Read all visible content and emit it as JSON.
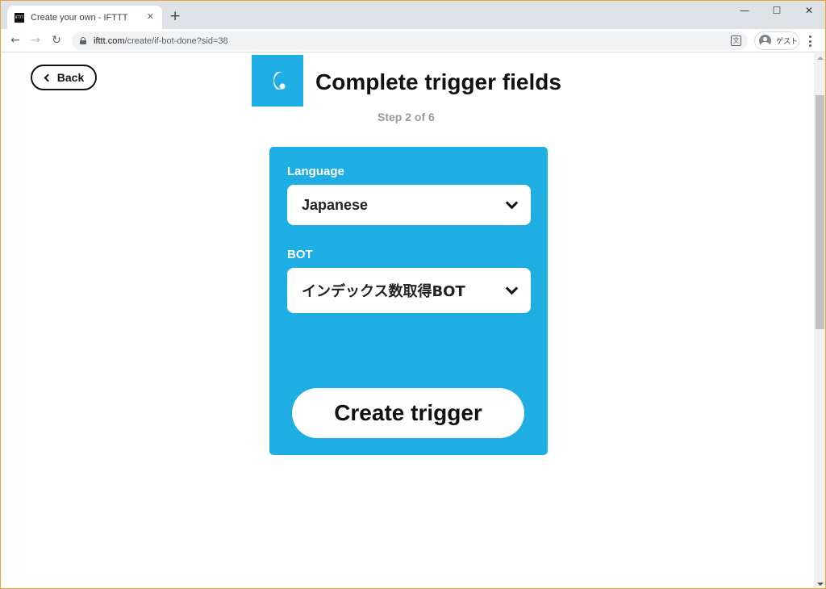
{
  "browser": {
    "tab_title": "Create your own - IFTTT",
    "favicon_text": "IFTTT",
    "new_tab_symbol": "+",
    "close_tab_symbol": "✕",
    "url_host": "ifttt.com",
    "url_path": "/create/if-bot-done?sid=38",
    "translate_symbol": "文",
    "profile_name": "ゲスト",
    "window_controls": {
      "minimize": "—",
      "maximize": "☐",
      "close": "✕"
    },
    "nav": {
      "back": "←",
      "forward": "→",
      "reload": "↻"
    }
  },
  "page": {
    "back_label": "Back",
    "title": "Complete trigger fields",
    "step": "Step 2 of 6",
    "service_color": "#1faee4"
  },
  "form": {
    "fields": [
      {
        "label": "Language",
        "value": "Japanese"
      },
      {
        "label": "BOT",
        "value": "インデックス数取得BOT"
      }
    ],
    "submit_label": "Create trigger"
  }
}
